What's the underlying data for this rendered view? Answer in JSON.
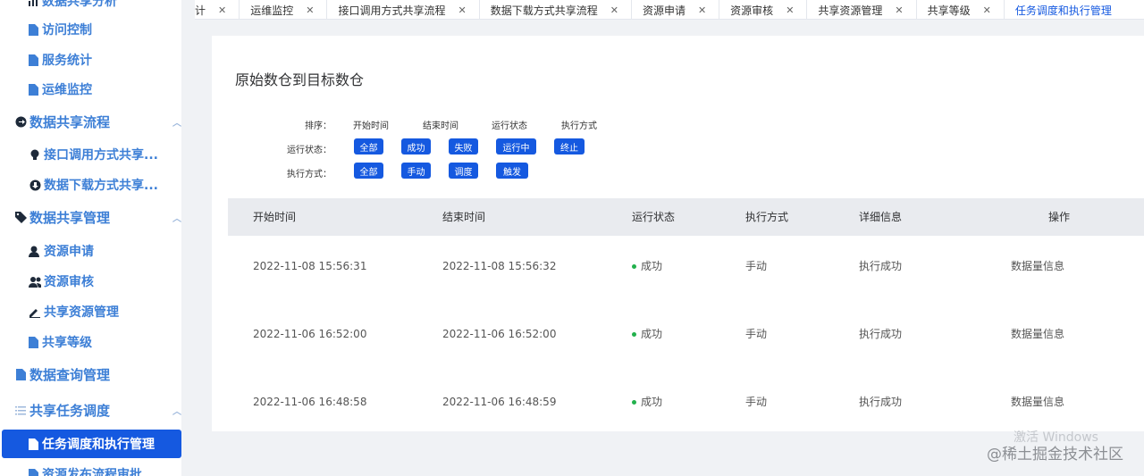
{
  "sidebar": {
    "top_partial": "数据共享分析",
    "items": [
      {
        "label": "访问控制"
      },
      {
        "label": "服务统计"
      },
      {
        "label": "运维监控"
      }
    ],
    "group_flow": "数据共享流程",
    "flow_items": [
      {
        "label": "接口调用方式共享..."
      },
      {
        "label": "数据下载方式共享..."
      }
    ],
    "group_manage": "数据共享管理",
    "manage_items": [
      {
        "label": "资源申请"
      },
      {
        "label": "资源审核"
      },
      {
        "label": "共享资源管理"
      },
      {
        "label": "共享等级"
      }
    ],
    "query": "数据查询管理",
    "group_task": "共享任务调度",
    "active": "任务调度和执行管理",
    "bottom_partial": "资源发布流程审批"
  },
  "tabs": [
    {
      "label": "计"
    },
    {
      "label": "运维监控"
    },
    {
      "label": "接口调用方式共享流程"
    },
    {
      "label": "数据下载方式共享流程"
    },
    {
      "label": "资源申请"
    },
    {
      "label": "资源审核"
    },
    {
      "label": "共享资源管理"
    },
    {
      "label": "共享等级"
    },
    {
      "label": "任务调度和执行管理"
    }
  ],
  "page": {
    "title": "原始数仓到目标数仓"
  },
  "filters": {
    "sort_label": "排序：",
    "sort_options": [
      "开始时间",
      "结束时间",
      "运行状态",
      "执行方式"
    ],
    "status_label": "运行状态：",
    "status_options": [
      "全部",
      "成功",
      "失败",
      "运行中",
      "终止"
    ],
    "mode_label": "执行方式：",
    "mode_options": [
      "全部",
      "手动",
      "调度",
      "触发"
    ]
  },
  "table": {
    "headers": [
      "开始时间",
      "结束时间",
      "运行状态",
      "执行方式",
      "详细信息",
      "操作"
    ],
    "rows": [
      {
        "start": "2022-11-08 15:56:31",
        "end": "2022-11-08 15:56:32",
        "status": "成功",
        "mode": "手动",
        "detail": "执行成功",
        "action": "数据量信息"
      },
      {
        "start": "2022-11-06 16:52:00",
        "end": "2022-11-06 16:52:00",
        "status": "成功",
        "mode": "手动",
        "detail": "执行成功",
        "action": "数据量信息"
      },
      {
        "start": "2022-11-06 16:48:58",
        "end": "2022-11-06 16:48:59",
        "status": "成功",
        "mode": "手动",
        "detail": "执行成功",
        "action": "数据量信息"
      }
    ]
  },
  "overlay": {
    "windows": "激活 Windows",
    "juejin": "@稀土掘金技术社区"
  },
  "colors": {
    "accent": "#1559e0",
    "sidebar_text": "#3d7fd6",
    "success": "#22b14c"
  },
  "icons": {
    "file": "file-icon",
    "arrow": "arrow-circle-icon",
    "bulb": "lightbulb-icon",
    "download": "download-icon",
    "tag": "tag-icon",
    "user-apply": "user-apply-icon",
    "users": "users-icon",
    "edit": "edit-icon",
    "list": "list-icon",
    "chevron": "chevron-up-icon",
    "close": "close-icon"
  }
}
